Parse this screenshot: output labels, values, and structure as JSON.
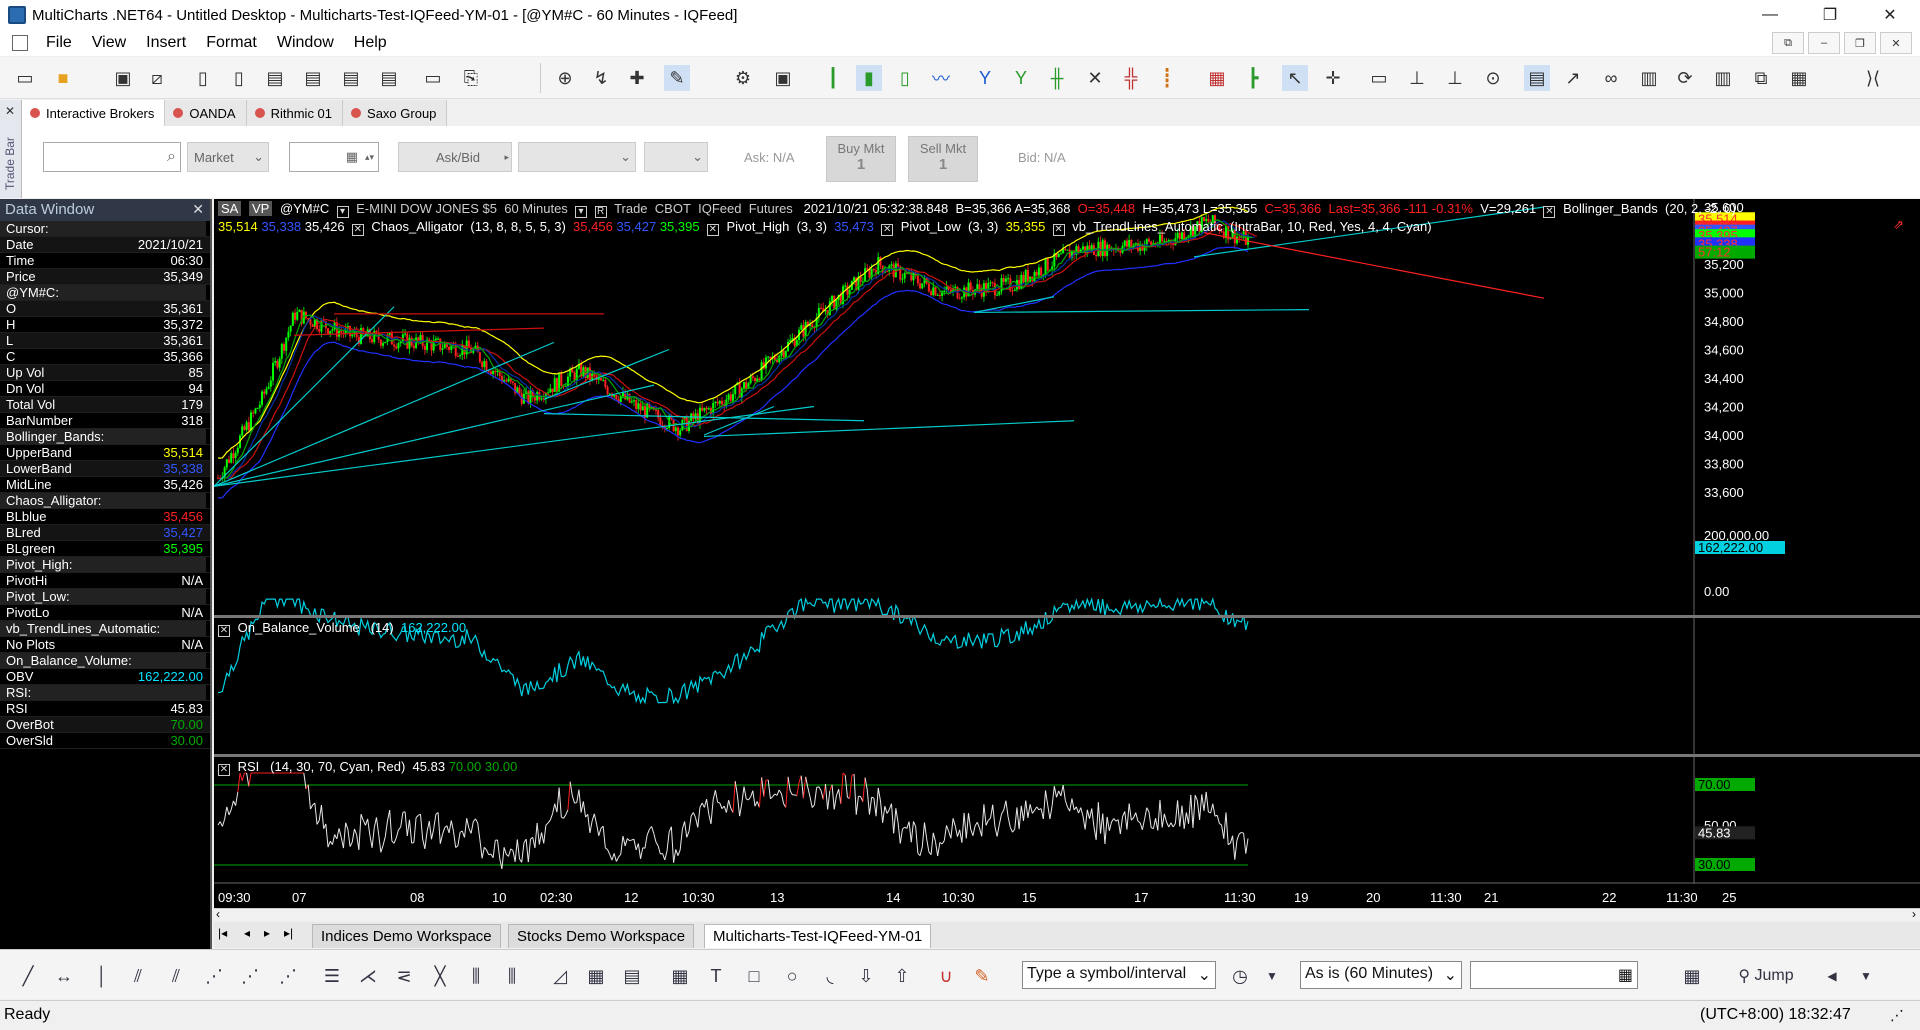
{
  "window": {
    "title": "MultiCharts .NET64 - Untitled Desktop - Multicharts-Test-IQFeed-YM-01 - [@YM#C - 60 Minutes - IQFeed]",
    "minimize": "—",
    "maximize": "❐",
    "close": "✕"
  },
  "menu": [
    "File",
    "View",
    "Insert",
    "Format",
    "Window",
    "Help"
  ],
  "trade_bar": {
    "side_label": "Trade Bar",
    "close": "✕",
    "brokers": [
      "Interactive Brokers",
      "OANDA",
      "Rithmic 01",
      "Saxo Group"
    ],
    "order_type": "Market",
    "ask_bid": "Ask/Bid",
    "buy_label": "Buy Mkt",
    "buy_qty": "1",
    "sell_label": "Sell Mkt",
    "sell_qty": "1",
    "ask": "Ask: N/A",
    "bid": "Bid: N/A"
  },
  "data_window": {
    "title": "Data Window",
    "rows": [
      {
        "k": "Cursor:",
        "v": "",
        "sec": true
      },
      {
        "k": "Date",
        "v": "2021/10/21",
        "c": "#ffffff"
      },
      {
        "k": "Time",
        "v": "06:30",
        "c": "#ffffff"
      },
      {
        "k": "Price",
        "v": "35,349",
        "c": "#ffffff"
      },
      {
        "k": "@YM#C:",
        "v": "",
        "sec": true
      },
      {
        "k": "O",
        "v": "35,361",
        "c": "#ffffff"
      },
      {
        "k": "H",
        "v": "35,372",
        "c": "#ffffff"
      },
      {
        "k": "L",
        "v": "35,361",
        "c": "#ffffff"
      },
      {
        "k": "C",
        "v": "35,366",
        "c": "#ffffff"
      },
      {
        "k": "Up Vol",
        "v": "85",
        "c": "#ffffff"
      },
      {
        "k": "Dn Vol",
        "v": "94",
        "c": "#ffffff"
      },
      {
        "k": "Total Vol",
        "v": "179",
        "c": "#ffffff"
      },
      {
        "k": "BarNumber",
        "v": "318",
        "c": "#ffffff"
      },
      {
        "k": "Bollinger_Bands:",
        "v": "",
        "sec": true
      },
      {
        "k": "UpperBand",
        "v": "35,514",
        "c": "#ffff00"
      },
      {
        "k": "LowerBand",
        "v": "35,338",
        "c": "#3355ff"
      },
      {
        "k": "MidLine",
        "v": "35,426",
        "c": "#ffffff"
      },
      {
        "k": "Chaos_Alligator:",
        "v": "",
        "sec": true
      },
      {
        "k": "BLblue",
        "v": "35,456",
        "c": "#ff2020"
      },
      {
        "k": "BLred",
        "v": "35,427",
        "c": "#3355ff"
      },
      {
        "k": "BLgreen",
        "v": "35,395",
        "c": "#00ff00"
      },
      {
        "k": "Pivot_High:",
        "v": "",
        "sec": true
      },
      {
        "k": "PivotHi",
        "v": "N/A",
        "c": "#ffffff"
      },
      {
        "k": "Pivot_Low:",
        "v": "",
        "sec": true
      },
      {
        "k": "PivotLo",
        "v": "N/A",
        "c": "#ffffff"
      },
      {
        "k": "vb_TrendLines_Automatic:",
        "v": "",
        "sec": true
      },
      {
        "k": "No Plots",
        "v": "N/A",
        "c": "#ffffff"
      },
      {
        "k": "On_Balance_Volume:",
        "v": "",
        "sec": true
      },
      {
        "k": "OBV",
        "v": "162,222.00",
        "c": "#00e5ff"
      },
      {
        "k": "RSI:",
        "v": "",
        "sec": true
      },
      {
        "k": "RSI",
        "v": "45.83",
        "c": "#ffffff"
      },
      {
        "k": "OverBot",
        "v": "70.00",
        "c": "#00aa00"
      },
      {
        "k": "OverSld",
        "v": "30.00",
        "c": "#00aa00"
      }
    ]
  },
  "chart": {
    "sa": "SA",
    "vp": "VP",
    "symbol": "@YM#C",
    "description": "E-MINI DOW JONES $5",
    "interval": "60 Minutes",
    "mode": "Trade",
    "exchange": "CBOT",
    "feed": "IQFeed",
    "category": "Futures",
    "datetime": "2021/10/21  05:32:38.848",
    "bid_ask": "B=35,366  A=35,368",
    "open": "O=35,448",
    "hl": "H=35,473  L=35,355",
    "close": "C=35,366",
    "last": "Last=35,366  -111  -0.31%",
    "volume": "V=29,261",
    "bb_name": "Bollinger_Bands",
    "bb_params": "(20,  2,  -2,  0)",
    "bb_vals": [
      "35,514",
      "35,338",
      "35,426"
    ],
    "alli_name": "Chaos_Alligator",
    "alli_params": "(13,  8,  8,  5,  5,  3)",
    "alli_vals": [
      "35,456",
      "35,427",
      "35,395"
    ],
    "ph_name": "Pivot_High",
    "ph_params": "(3,  3)",
    "ph_val": "35,473",
    "pl_name": "Pivot_Low",
    "pl_params": "(3,  3)",
    "pl_val": "35,355",
    "tl_name": "vb_TrendLines_Automatic",
    "tl_params": "(IntraBar,  10,  Red,  Yes,  4,  4,  Cyan)",
    "price_axis": [
      "35,600",
      "35,400",
      "35,200",
      "35,000",
      "34,800",
      "34,600",
      "34,400",
      "34,200",
      "34,000",
      "33,800",
      "33,600"
    ],
    "price_markers": [
      "35,514",
      "35,456",
      "35,427",
      "35,395",
      "35,338",
      "57:12"
    ],
    "obv_title": "On_Balance_Volume",
    "obv_params": "(14)",
    "obv_val": "162,222.00",
    "obv_axis": [
      "200,000.00",
      "0.00"
    ],
    "obv_marker": "162,222.00",
    "rsi_title": "RSI",
    "rsi_params": "(14,  30,  70,  Cyan,  Red)",
    "rsi_vals": [
      "45.83",
      "70.00",
      "30.00"
    ],
    "rsi_axis": [
      "70.00",
      "50.00",
      "30.00"
    ],
    "rsi_marker": "45.83",
    "time_axis": [
      "09:30",
      "07",
      "08",
      "10",
      "02:30",
      "12",
      "10:30",
      "13",
      "14",
      "10:30",
      "15",
      "17",
      "11:30",
      "19",
      "20",
      "11:30",
      "21",
      "22",
      "11:30",
      "25"
    ]
  },
  "workspaces": [
    "Indices Demo Workspace",
    "Stocks Demo Workspace",
    "Multicharts-Test-IQFeed-YM-01"
  ],
  "drawbar": {
    "symbol_placeholder": "Type a symbol/interval",
    "interval_mode": "As is (60 Minutes)",
    "jump": "Jump"
  },
  "status": {
    "left": "Ready",
    "clock": "(UTC+8:00) 18:32:47"
  }
}
